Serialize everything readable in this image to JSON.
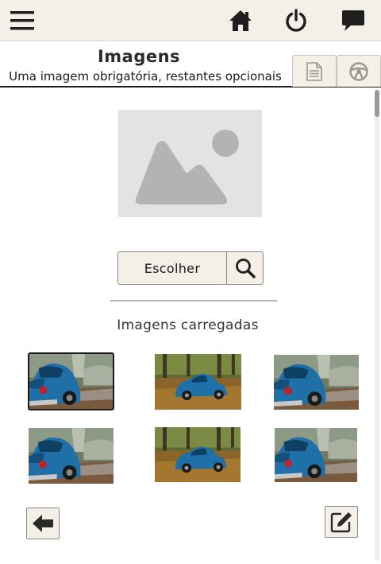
{
  "toolbar": {
    "icons": [
      "menu-icon",
      "home-icon",
      "power-icon",
      "chat-icon"
    ]
  },
  "header": {
    "title": "Imagens",
    "subtitle": "Uma imagem obrigatória, restantes opcionais",
    "tabs": [
      "document-icon",
      "steering-wheel-icon"
    ]
  },
  "upload": {
    "choose_label": "Escolher",
    "search_icon": "search-icon"
  },
  "gallery": {
    "label": "Imagens carregadas",
    "selected_index": 0,
    "thumbnails": [
      {
        "variant": "closeup"
      },
      {
        "variant": "wide"
      },
      {
        "variant": "closeup"
      },
      {
        "variant": "closeup"
      },
      {
        "variant": "wide"
      },
      {
        "variant": "closeup"
      }
    ]
  },
  "footer": {
    "back_icon": "arrow-left-icon",
    "edit_icon": "edit-icon"
  },
  "colors": {
    "toolbar_bg": "#f4f0e7",
    "icon_dark": "#1f1f1f",
    "placeholder_bg": "#e3e3e3",
    "placeholder_shape": "#b3b3b3",
    "car_blue": "#1f6fa8"
  }
}
